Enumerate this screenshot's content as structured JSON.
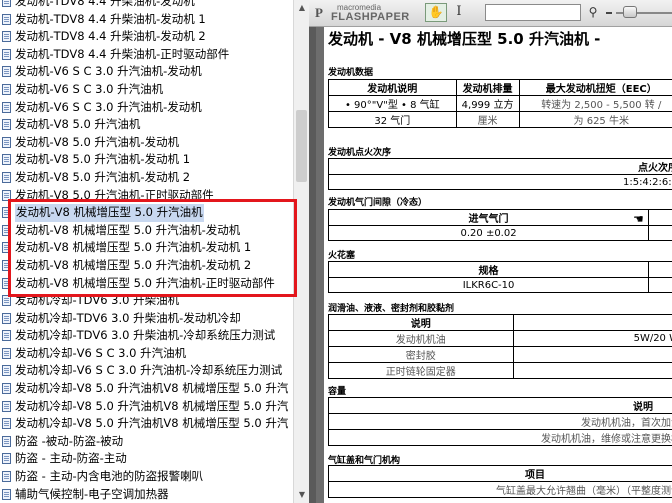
{
  "tree": {
    "items": [
      {
        "label": "发动机-TDV8 4.4 升柴油机-发动机"
      },
      {
        "label": "发动机-TDV8 4.4 升柴油机-发动机 1"
      },
      {
        "label": "发动机-TDV8 4.4 升柴油机-发动机 2"
      },
      {
        "label": "发动机-TDV8 4.4 升柴油机-正时驱动部件"
      },
      {
        "label": "发动机-V6 S C 3.0 升汽油机-发动机"
      },
      {
        "label": "发动机-V6 S C 3.0 升汽油机"
      },
      {
        "label": "发动机-V6 S C 3.0 升汽油机-发动机"
      },
      {
        "label": "发动机-V8 5.0 升汽油机"
      },
      {
        "label": "发动机-V8 5.0 升汽油机-发动机"
      },
      {
        "label": "发动机-V8 5.0 升汽油机-发动机 1"
      },
      {
        "label": "发动机-V8 5.0 升汽油机-发动机 2"
      },
      {
        "label": "发动机-V8 5.0 升汽油机-正时驱动部件"
      },
      {
        "label": "发动机-V8 机械增压型 5.0 升汽油机",
        "selected": true
      },
      {
        "label": "发动机-V8 机械增压型 5.0 升汽油机-发动机"
      },
      {
        "label": "发动机-V8 机械增压型 5.0 升汽油机-发动机 1"
      },
      {
        "label": "发动机-V8 机械增压型 5.0 升汽油机-发动机 2"
      },
      {
        "label": "发动机-V8 机械增压型 5.0 升汽油机-正时驱动部件"
      },
      {
        "label": "发动机冷却-TDV6 3.0 升柴油机"
      },
      {
        "label": "发动机冷却-TDV6 3.0 升柴油机-发动机冷却"
      },
      {
        "label": "发动机冷却-TDV6 3.0 升柴油机-冷却系统压力测试"
      },
      {
        "label": "发动机冷却-V6 S C 3.0 升汽油机"
      },
      {
        "label": "发动机冷却-V6 S C 3.0 升汽油机-冷却系统压力测试"
      },
      {
        "label": "发动机冷却-V8 5.0 升汽油机V8 机械增压型 5.0 升汽"
      },
      {
        "label": "发动机冷却-V8 5.0 升汽油机V8 机械增压型 5.0 升汽"
      },
      {
        "label": "发动机冷却-V8 5.0 升汽油机V8 机械增压型 5.0 升汽"
      },
      {
        "label": "防盗 -被动-防盗-被动"
      },
      {
        "label": "防盗 - 主动-防盗-主动"
      },
      {
        "label": "防盗 - 主动-内含电池的防盗报警喇叭"
      },
      {
        "label": "辅助气候控制-电子空调加热器"
      }
    ]
  },
  "viewer": {
    "brand_small": "macromedia",
    "brand_big": "FLASHPAPER",
    "search_value": "",
    "zoom_level": 0.2
  },
  "doc": {
    "title": "发动机 - V8 机械增压型 5.0 升汽油机 -",
    "sections": {
      "engine_data": "发动机数据",
      "firing": "发动机点火次序",
      "valve": "发动机气门间隙（冷态）",
      "spark": "火花塞",
      "lube": "润滑油、液液、密封剂和胶黏剂",
      "capacity": "容量",
      "cylinder": "气缸盖和气门机构"
    },
    "engine_table": {
      "headers": [
        "发动机说明",
        "发动机排量",
        "最大发动机扭矩（EEC）"
      ],
      "values": [
        "• 90°\"V\"型 • 8 气缸",
        "4,999 立方",
        "转速为 2,500 - 5,500 转 /"
      ],
      "values2": [
        "32 气门",
        "厘米",
        "为 625 牛米"
      ]
    },
    "firing_table": {
      "header": "点火次序",
      "value": "1:5:4:2:6:3"
    },
    "valve_table": {
      "header": "进气气门",
      "value": "0.20 ±0.02"
    },
    "spark_table": {
      "header": "规格",
      "value": "ILKR6C-10"
    },
    "lube_table": {
      "header": "说明",
      "rows": [
        {
          "name": "发动机机油",
          "spec": "5W/20 W"
        },
        {
          "name": "密封胶",
          "spec": ""
        },
        {
          "name": "正时链轮固定器",
          "spec": ""
        }
      ]
    },
    "capacity_table": {
      "header": "说明",
      "rows": [
        "发动机机油，首次加注",
        "发动机机油，维修或注意更换机"
      ]
    },
    "cylinder_table": {
      "header": "项目",
      "row": "气缸盖最大允许翘曲（毫米）（平整度测试"
    }
  }
}
